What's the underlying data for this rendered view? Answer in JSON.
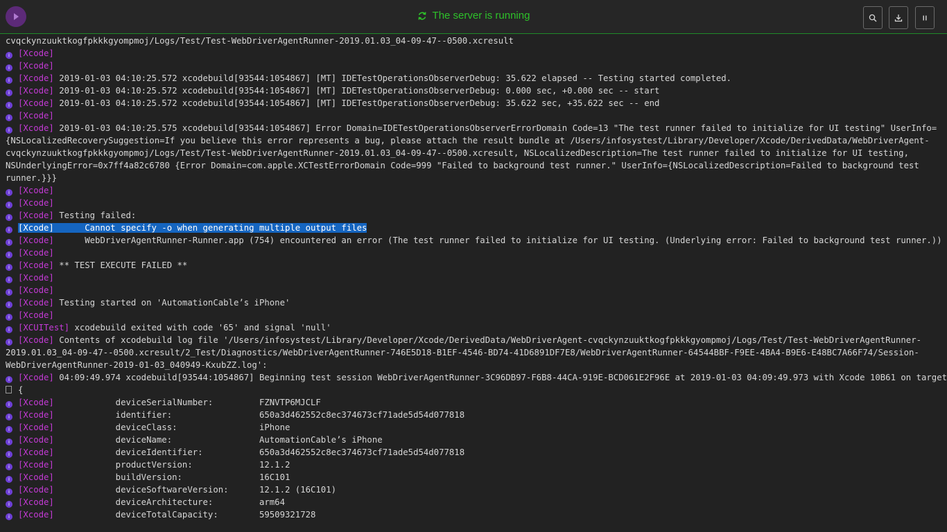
{
  "header": {
    "status": "The server is running",
    "status_color": "#2ec12a",
    "logo_icon": "appium-logo",
    "buttons": {
      "search": "search-icon",
      "download": "download-icon",
      "pause": "pause-icon"
    }
  },
  "log": {
    "tag_color": "#c43ad6",
    "highlight_color": "#1565c0",
    "lines": [
      {
        "text": "cvqckynzuuktkogfpkkkgyompmoj/Logs/Test/Test-WebDriverAgentRunner-2019.01.03_04-09-47--0500.xcresult"
      },
      {
        "tag": "[Xcode]",
        "text": ""
      },
      {
        "tag": "[Xcode]",
        "text": ""
      },
      {
        "tag": "[Xcode]",
        "text": " 2019-01-03 04:10:25.572 xcodebuild[93544:1054867] [MT] IDETestOperationsObserverDebug: 35.622 elapsed -- Testing started completed."
      },
      {
        "tag": "[Xcode]",
        "text": " 2019-01-03 04:10:25.572 xcodebuild[93544:1054867] [MT] IDETestOperationsObserverDebug: 0.000 sec, +0.000 sec -- start"
      },
      {
        "tag": "[Xcode]",
        "text": " 2019-01-03 04:10:25.572 xcodebuild[93544:1054867] [MT] IDETestOperationsObserverDebug: 35.622 sec, +35.622 sec -- end"
      },
      {
        "tag": "[Xcode]",
        "text": ""
      },
      {
        "tag": "[Xcode]",
        "text": " 2019-01-03 04:10:25.575 xcodebuild[93544:1054867] Error Domain=IDETestOperationsObserverErrorDomain Code=13 \"The test runner failed to initialize for UI testing\" UserInfo="
      },
      {
        "text": "{NSLocalizedRecoverySuggestion=If you believe this error represents a bug, please attach the result bundle at /Users/infosystest/Library/Developer/Xcode/DerivedData/WebDriverAgent-"
      },
      {
        "text": "cvqckynzuuktkogfpkkkgyompmoj/Logs/Test/Test-WebDriverAgentRunner-2019.01.03_04-09-47--0500.xcresult, NSLocalizedDescription=The test runner failed to initialize for UI testing,"
      },
      {
        "text": "NSUnderlyingError=0x7ff4a82c6780 {Error Domain=com.apple.XCTestErrorDomain Code=999 \"Failed to background test runner.\" UserInfo={NSLocalizedDescription=Failed to background test"
      },
      {
        "text": "runner.}}}"
      },
      {
        "tag": "[Xcode]",
        "text": ""
      },
      {
        "tag": "[Xcode]",
        "text": ""
      },
      {
        "tag": "[Xcode]",
        "text": " Testing failed:"
      },
      {
        "tag": "[Xcode]",
        "text": "      Cannot specify -o when generating multiple output files",
        "selected": true
      },
      {
        "tag": "[Xcode]",
        "text": "      WebDriverAgentRunner-Runner.app (754) encountered an error (The test runner failed to initialize for UI testing. (Underlying error: Failed to background test runner.))"
      },
      {
        "tag": "[Xcode]",
        "text": ""
      },
      {
        "tag": "[Xcode]",
        "text": " ** TEST EXECUTE FAILED **"
      },
      {
        "tag": "[Xcode]",
        "text": ""
      },
      {
        "tag": "[Xcode]",
        "text": ""
      },
      {
        "tag": "[Xcode]",
        "text": " Testing started on 'AutomationCable’s iPhone'"
      },
      {
        "tag": "[Xcode]",
        "text": ""
      },
      {
        "tag": "[XCUITest]",
        "text": " xcodebuild exited with code '65' and signal 'null'"
      },
      {
        "tag": "[Xcode]",
        "text": " Contents of xcodebuild log file '/Users/infosystest/Library/Developer/Xcode/DerivedData/WebDriverAgent-cvqckynzuuktkogfpkkkgyompmoj/Logs/Test/Test-WebDriverAgentRunner-"
      },
      {
        "text": "2019.01.03_04-09-47--0500.xcresult/2_Test/Diagnostics/WebDriverAgentRunner-746E5D18-B1EF-4546-BD74-41D6891DF7E8/WebDriverAgentRunner-64544BBF-F9EE-4BA4-B9E6-E48BC7A66F74/Session-"
      },
      {
        "text": "WebDriverAgentRunner-2019-01-03_040949-KxubZZ.log':"
      },
      {
        "tag": "[Xcode]",
        "text": " 04:09:49.974 xcodebuild[93544:1054867] Beginning test session WebDriverAgentRunner-3C96DB97-F6B8-44CA-919E-BCD061E2F96E at 2019-01-03 04:09:49.973 with Xcode 10B61 on target"
      },
      {
        "debug": true,
        "text": "{"
      },
      {
        "tag": "[Xcode]",
        "text": "            deviceSerialNumber:         FZNVTP6MJCLF"
      },
      {
        "tag": "[Xcode]",
        "text": "            identifier:                 650a3d462552c8ec374673cf71ade5d54d077818"
      },
      {
        "tag": "[Xcode]",
        "text": "            deviceClass:                iPhone"
      },
      {
        "tag": "[Xcode]",
        "text": "            deviceName:                 AutomationCable’s iPhone"
      },
      {
        "tag": "[Xcode]",
        "text": "            deviceIdentifier:           650a3d462552c8ec374673cf71ade5d54d077818"
      },
      {
        "tag": "[Xcode]",
        "text": "            productVersion:             12.1.2"
      },
      {
        "tag": "[Xcode]",
        "text": "            buildVersion:               16C101"
      },
      {
        "tag": "[Xcode]",
        "text": "            deviceSoftwareVersion:      12.1.2 (16C101)"
      },
      {
        "tag": "[Xcode]",
        "text": "            deviceArchitecture:         arm64"
      },
      {
        "tag": "[Xcode]",
        "text": "            deviceTotalCapacity:        59509321728"
      }
    ]
  }
}
